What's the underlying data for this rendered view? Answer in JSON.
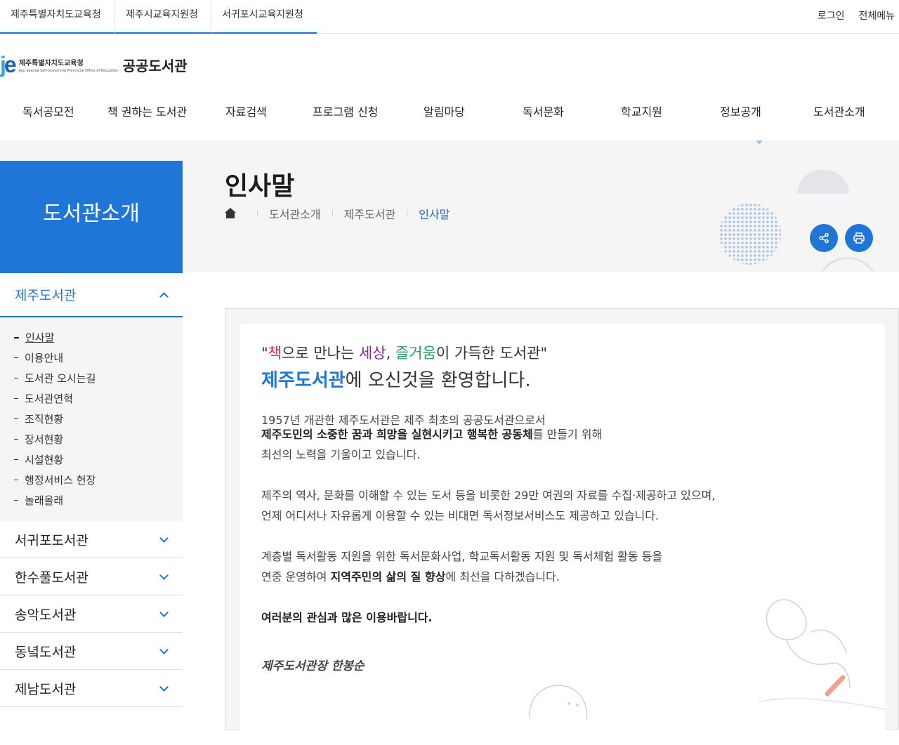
{
  "topbar": {
    "sites": [
      "제주특별자치도교육청",
      "제주시교육지원청",
      "서귀포시교육지원청"
    ],
    "login": "로그인",
    "all_menu": "전체메뉴"
  },
  "logo": {
    "mark": "je",
    "korean": "제주특별자치도교육청",
    "english": "Jeju Special Self-Governing Provincial Office of Education",
    "brand": "공공도서관"
  },
  "gnb": [
    "독서공모전",
    "책 권하는 도서관",
    "자료검색",
    "프로그램 신청",
    "알림마당",
    "독서문화",
    "학교지원",
    "정보공개",
    "도서관소개"
  ],
  "hero": {
    "section_title": "도서관소개",
    "page_title": "인사말",
    "breadcrumb": [
      "도서관소개",
      "제주도서관",
      "인사말"
    ]
  },
  "lnb": {
    "current": "제주도서관",
    "sub_items": [
      "인사말",
      "이용안내",
      "도서관 오시는길",
      "도서관연혁",
      "조직현황",
      "장서현황",
      "시설현황",
      "행정서비스 헌장",
      "놀래올래"
    ],
    "libraries": [
      "서귀포도서관",
      "한수풀도서관",
      "송악도서관",
      "동녘도서관",
      "제남도서관"
    ]
  },
  "greeting": {
    "q1": [
      "\"",
      "책",
      "으로 만나는 ",
      "세상",
      ", ",
      "즐거움",
      "이 가득한 도서관\""
    ],
    "q2_bold": "제주도서관",
    "q2_rest": "에 오신것을 환영합니다.",
    "p1_line1": "1957년 개관한 제주도서관은 제주 최초의 공공도서관으로서",
    "p1_line2_bold": "제주도민의 소중한 꿈과 희망을 실현시키고 행복한 공동체",
    "p1_line2_rest": "를 만들기 위해",
    "p1_line3": "최선의 노력을 기울이고 있습니다.",
    "p2_line1": "제주의 역사, 문화를 이해할 수 있는 도서 등을 비롯한 29만 여권의 자료를 수집·제공하고 있으며,",
    "p2_line2": "언제 어디서나 자유롭게 이용할 수 있는 비대면 독서정보서비스도 제공하고 있습니다.",
    "p3_line1": "계층별 독서활동 지원을 위한 독서문화사업, 학교독서활동 지원 및 독서체험 활동 등을",
    "p3_line2_pre": "연중 운영하여 ",
    "p3_line2_bold": "지역주민의 삶의 질 향상",
    "p3_line2_rest": "에 최선을 다하겠습니다.",
    "closing": "여러분의 관심과 많은 이용바랍니다.",
    "signature": "제주도서관장 한봉순"
  },
  "icons": {
    "home": "home-icon",
    "share": "share-icon",
    "print": "print-icon"
  },
  "colors": {
    "primary": "#1f76d6",
    "red": "#e0262d",
    "purple": "#8a2aa0",
    "green": "#2c9b5c"
  }
}
